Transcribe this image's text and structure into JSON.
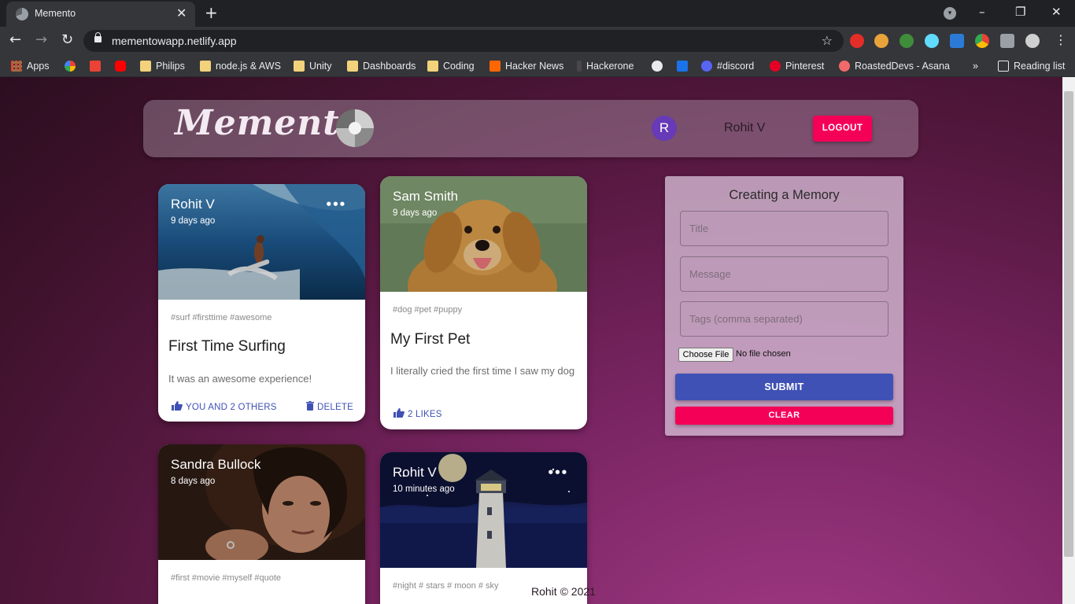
{
  "browser": {
    "tab_title": "Memento",
    "tab_close": "✕",
    "new_tab": "+",
    "url": "mementowapp.netlify.app",
    "window_controls": [
      "–",
      "❐",
      "✕"
    ],
    "bookmarks": [
      {
        "label": "Apps",
        "icon": "apps-grid-icon"
      },
      {
        "label": "",
        "icon": "google-icon"
      },
      {
        "label": "",
        "icon": "gmail-icon"
      },
      {
        "label": "",
        "icon": "youtube-icon"
      },
      {
        "label": "Philips",
        "icon": "folder-icon"
      },
      {
        "label": "node.js & AWS",
        "icon": "folder-icon"
      },
      {
        "label": "Unity",
        "icon": "folder-icon"
      },
      {
        "label": "Dashboards",
        "icon": "folder-icon"
      },
      {
        "label": "Coding",
        "icon": "folder-icon"
      },
      {
        "label": "Hacker News",
        "icon": "hackernews-icon"
      },
      {
        "label": "Hackerone",
        "icon": "hackerone-icon"
      },
      {
        "label": "",
        "icon": "github-icon"
      },
      {
        "label": "",
        "icon": "bookmark-icon"
      },
      {
        "label": "#discord",
        "icon": "discord-icon"
      },
      {
        "label": "Pinterest",
        "icon": "pinterest-icon"
      },
      {
        "label": "RoastedDevs - Asana",
        "icon": "asana-icon"
      }
    ],
    "bookmarks_overflow": "»",
    "reading_list": "Reading list"
  },
  "app": {
    "brand": "Memento",
    "avatar_letter": "R",
    "username": "Rohit V",
    "logout": "LOGOUT"
  },
  "posts": [
    {
      "author": "Rohit V",
      "time": "9 days ago",
      "more": "•••",
      "tags": "#surf #firsttime #awesome",
      "title": "First Time Surfing",
      "message": "It was an awesome experience!",
      "likes": "YOU AND 2 OTHERS",
      "delete": "DELETE",
      "image": "surf"
    },
    {
      "author": "Sam Smith",
      "time": "9 days ago",
      "more": "",
      "tags": "#dog #pet #puppy",
      "title": "My First Pet",
      "message": "I literally cried the first time I saw my dog",
      "likes": "2 LIKES",
      "delete": "",
      "image": "dog"
    },
    {
      "author": "Sandra Bullock",
      "time": "8 days ago",
      "more": "",
      "tags": "#first #movie #myself #quote",
      "title": "",
      "message": "",
      "likes": "",
      "delete": "",
      "image": "portrait"
    },
    {
      "author": "Rohit V",
      "time": "10 minutes ago",
      "more": "•••",
      "tags": "#night # stars # moon # sky",
      "title": "",
      "message": "",
      "likes": "",
      "delete": "",
      "image": "lighthouse"
    }
  ],
  "form": {
    "title": "Creating a Memory",
    "title_placeholder": "Title",
    "message_placeholder": "Message",
    "tags_placeholder": "Tags (comma separated)",
    "file_button": "Choose File",
    "file_status": "No file chosen",
    "submit": "SUBMIT",
    "clear": "CLEAR"
  },
  "footer": "Rohit © 2021",
  "colors": {
    "primary": "#3f51b5",
    "secondary": "#f50057",
    "avatar": "#673ab7"
  }
}
